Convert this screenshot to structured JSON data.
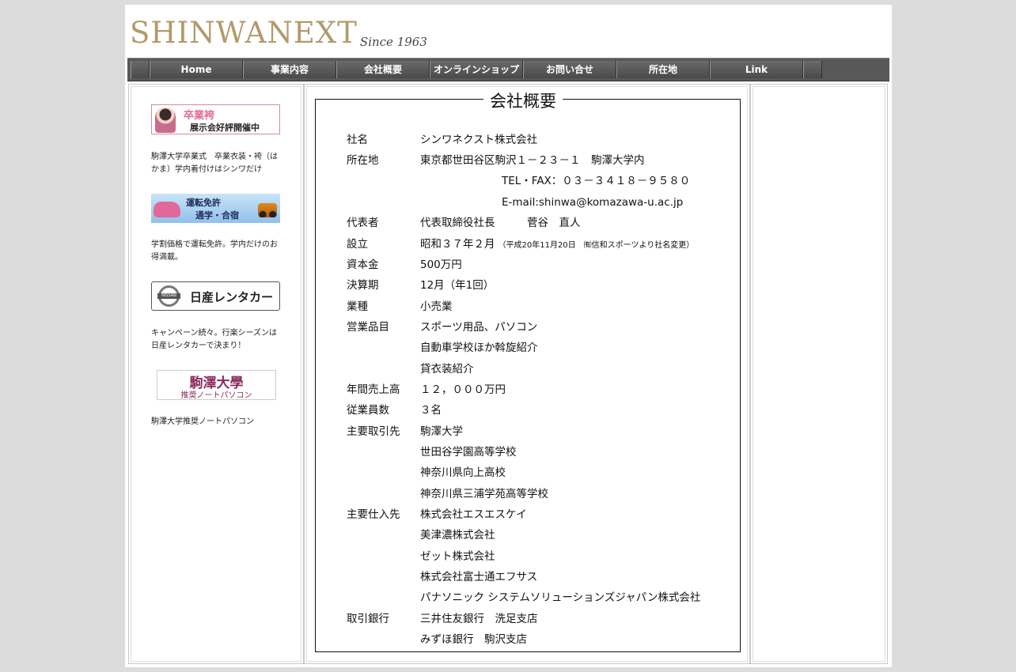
{
  "logo": {
    "brand": "SHINWANEXT",
    "tagline": "Since 1963"
  },
  "nav": [
    "Home",
    "事業内容",
    "会社概要",
    "オンラインショップ",
    "お問い合せ",
    "所在地",
    "Link"
  ],
  "sidebar": {
    "banners": [
      {
        "line1": "卒業袴",
        "line2": "展示会好評開催中",
        "caption": "駒澤大学卒業式　卒業衣装・袴（はかま）学内着付けはシンワだけ"
      },
      {
        "line1": "運転免許",
        "line2": "通学・合宿",
        "caption": "学割価格で運転免許。学内だけのお得満載。"
      },
      {
        "brand": "NISSAN",
        "line1": "日産レンタカー",
        "caption": "キャンペーン続々。行楽シーズンは日産レンタカーで決まり！"
      },
      {
        "line1": "駒澤大學",
        "line2": "推奨ノートパソコン",
        "caption": "駒澤大学推奨ノートパソコン"
      }
    ]
  },
  "profile": {
    "title": "会社概要",
    "rows": [
      {
        "label": "社名",
        "value": "シンワネクスト株式会社"
      },
      {
        "label": "所在地",
        "value": "東京都世田谷区駒沢１－２３－１　駒澤大学内"
      },
      {
        "label": "",
        "value": "TEL・FAX：０３－３４１８－９５８０"
      },
      {
        "label": "",
        "value": "E-mail:shinwa@komazawa-u.ac.jp"
      },
      {
        "label": "代表者",
        "value": "代表取締役社長　　　菅谷　直人"
      },
      {
        "label": "設立",
        "value": "昭和３７年２月",
        "note": "（平成20年11月20日　㈲信和スポーツより社名変更）"
      },
      {
        "label": "資本金",
        "value": "500万円"
      },
      {
        "label": "決算期",
        "value": "12月（年1回）"
      },
      {
        "label": "業種",
        "value": "小売業"
      },
      {
        "label": "営業品目",
        "value": "スポーツ用品、パソコン"
      },
      {
        "label": "",
        "value": "自動車学校ほか斡旋紹介"
      },
      {
        "label": "",
        "value": "貸衣装紹介"
      },
      {
        "label": "年間売上高",
        "value": "１２，０００万円"
      },
      {
        "label": "従業員数",
        "value": "３名"
      },
      {
        "label": "主要取引先",
        "value": "駒澤大学"
      },
      {
        "label": "",
        "value": "世田谷学園高等学校"
      },
      {
        "label": "",
        "value": "神奈川県向上高校"
      },
      {
        "label": "",
        "value": "神奈川県三浦学苑高等学校"
      },
      {
        "label": "主要仕入先",
        "value": "株式会社エスエスケイ"
      },
      {
        "label": "",
        "value": "美津濃株式会社"
      },
      {
        "label": "",
        "value": "ゼット株式会社"
      },
      {
        "label": "",
        "value": "株式会社富士通エフサス"
      },
      {
        "label": "",
        "value": "パナソニック システムソリューションズジャパン株式会社"
      },
      {
        "label": "取引銀行",
        "value": "三井住友銀行　洗足支店"
      },
      {
        "label": "",
        "value": "みずほ銀行　駒沢支店"
      }
    ]
  }
}
